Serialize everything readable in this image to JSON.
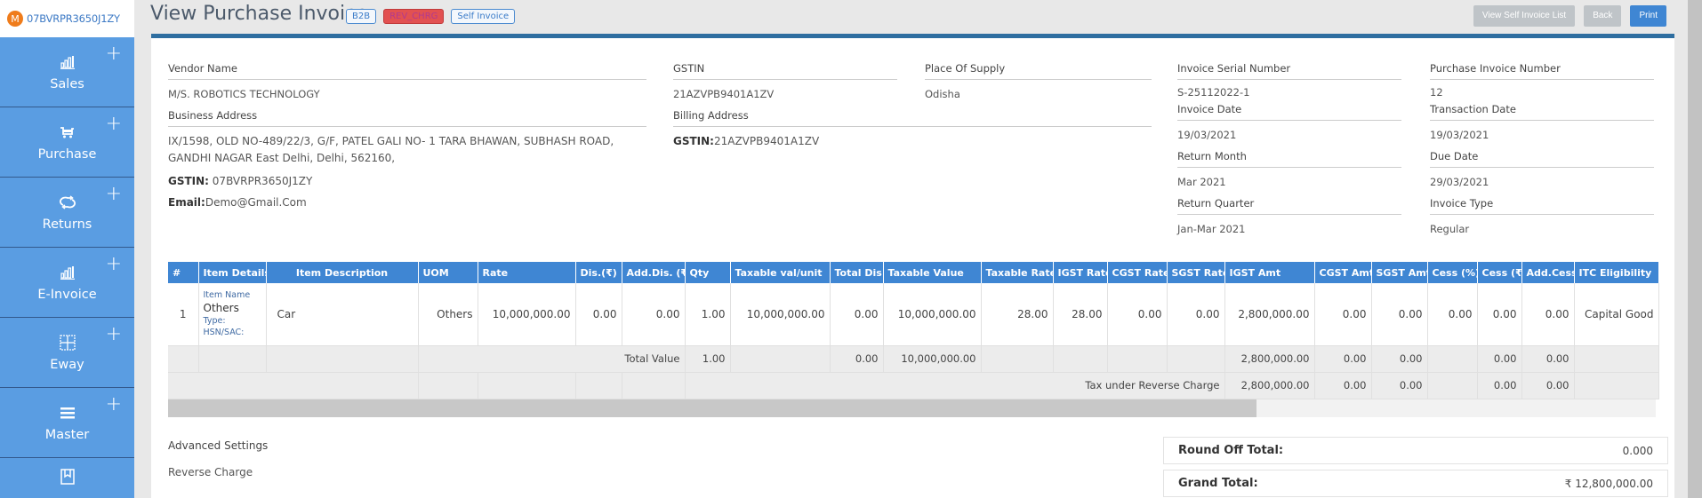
{
  "sidebar": {
    "avatar_letter": "M",
    "gstin": "07BVRPR3650J1ZY",
    "items": [
      {
        "label": "Sales",
        "icon": "bar-chart-icon"
      },
      {
        "label": "Purchase",
        "icon": "cart-icon"
      },
      {
        "label": "Returns",
        "icon": "refresh-icon"
      },
      {
        "label": "E-Invoice",
        "icon": "bar-chart-icon"
      },
      {
        "label": "Eway",
        "icon": "grid-icon"
      },
      {
        "label": "Master",
        "icon": "menu-icon"
      },
      {
        "label": "",
        "icon": "book-icon"
      }
    ],
    "plus": "+"
  },
  "header": {
    "title": "View Purchase Invoice",
    "badges": [
      "B2B",
      "REV_CHRG",
      "Self Invoice"
    ],
    "actions": {
      "view_self_invoice_list": "View Self Invoice List",
      "back": "Back",
      "print": "Print"
    }
  },
  "vendor": {
    "name_label": "Vendor Name",
    "name": "M/S. ROBOTICS TECHNOLOGY",
    "address_label": "Business Address",
    "address": "IX/1598, OLD NO-489/22/3, G/F, PATEL GALI NO- 1 TARA BHAWAN, SUBHASH ROAD, GANDHI NAGAR East Delhi, Delhi, 562160,",
    "gstin_label": "GSTIN:",
    "gstin": " 07BVRPR3650J1ZY",
    "email_label": "Email:",
    "email": "Demo@Gmail.Com"
  },
  "buyer": {
    "gstin_label": "GSTIN",
    "gstin": "21AZVPB9401A1ZV",
    "place_label": "Place Of Supply",
    "place": "Odisha",
    "billing_label": "Billing Address",
    "billing_gstin_label": "GSTIN:",
    "billing_gstin": "21AZVPB9401A1ZV"
  },
  "invoice": {
    "serial_label": "Invoice Serial Number",
    "serial": "S-25112022-1",
    "purchase_no_label": "Purchase Invoice Number",
    "purchase_no": "12",
    "date_label": "Invoice Date",
    "date": "19/03/2021",
    "txn_date_label": "Transaction Date",
    "txn_date": "19/03/2021",
    "return_month_label": "Return Month",
    "return_month": "Mar 2021",
    "due_date_label": "Due Date",
    "due_date": "29/03/2021",
    "return_quarter_label": "Return Quarter",
    "return_quarter": "Jan-Mar 2021",
    "type_label": "Invoice Type",
    "type": "Regular"
  },
  "table": {
    "headers": [
      "#",
      "Item Details",
      "Item Description",
      "UOM",
      "Rate",
      "Dis.(₹)",
      "Add.Dis. (₹)",
      "Qty",
      "Taxable val/unit",
      "Total Dis.",
      "Taxable Value",
      "Taxable Rate",
      "IGST Rate",
      "CGST Rate",
      "SGST Rate",
      "IGST Amt",
      "CGST Amt",
      "SGST Amt",
      "Cess (%)",
      "Cess (₹)",
      "Add.Cess",
      "ITC Eligibility"
    ],
    "rows": [
      {
        "no": "1",
        "item_name_label": "Item Name",
        "item_name": "Others",
        "type_label": "Type:",
        "hsn_label": "HSN/SAC:",
        "description": "Car",
        "uom": "Others",
        "rate": "10,000,000.00",
        "dis": "0.00",
        "add_dis": "0.00",
        "qty": "1.00",
        "taxable_unit": "10,000,000.00",
        "total_dis": "0.00",
        "taxable_value": "10,000,000.00",
        "taxable_rate": "28.00",
        "igst_rate": "28.00",
        "cgst_rate": "0.00",
        "sgst_rate": "0.00",
        "igst_amt": "2,800,000.00",
        "cgst_amt": "0.00",
        "sgst_amt": "0.00",
        "cess_pct": "0.00",
        "cess_amt": "0.00",
        "add_cess": "0.00",
        "itc": "Capital Good"
      }
    ],
    "total_row": {
      "label": "Total Value",
      "qty": "1.00",
      "total_dis": "0.00",
      "taxable_value": "10,000,000.00",
      "igst_amt": "2,800,000.00",
      "cgst_amt": "0.00",
      "sgst_amt": "0.00",
      "cess_amt": "0.00",
      "add_cess": "0.00"
    },
    "rc_row": {
      "label": "Tax under Reverse Charge",
      "igst_amt": "2,800,000.00",
      "cgst_amt": "0.00",
      "sgst_amt": "0.00",
      "cess_amt": "0.00",
      "add_cess": "0.00"
    }
  },
  "bottom": {
    "advanced_settings": "Advanced Settings",
    "reverse_charge": "Reverse Charge",
    "round_off_label": "Round Off Total:",
    "round_off": "0.000",
    "grand_total_label": "Grand Total:",
    "grand_total": "₹ 12,800,000.00"
  },
  "colors": {
    "sidebar": "#5a9de2",
    "primary": "#3f86d3",
    "rev_badge": "#e25151",
    "card_border": "#2e6ea0"
  }
}
